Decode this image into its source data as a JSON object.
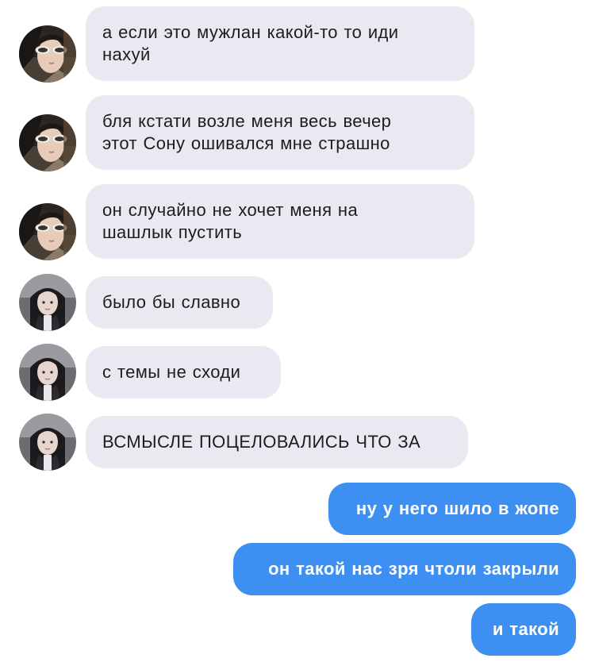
{
  "conversation": {
    "messages": [
      {
        "sender": "other-a",
        "avatar_icon": "avatar-sunglasses-icon",
        "lines": [
          "а если это мужлан какой-то то иди",
          "нахуй"
        ]
      },
      {
        "sender": "other-a",
        "avatar_icon": "avatar-sunglasses-icon",
        "lines": [
          "бля кстати возле меня весь вечер",
          "этот Сону ошивался мне страшно"
        ]
      },
      {
        "sender": "other-a",
        "avatar_icon": "avatar-sunglasses-icon",
        "lines": [
          "он случайно не хочет меня на",
          "шашлык пустить"
        ]
      },
      {
        "sender": "other-b",
        "avatar_icon": "avatar-girl-icon",
        "lines": [
          "было бы славно"
        ]
      },
      {
        "sender": "other-b",
        "avatar_icon": "avatar-girl-icon",
        "lines": [
          "с темы не сходи"
        ]
      },
      {
        "sender": "other-b",
        "avatar_icon": "avatar-girl-icon",
        "lines": [
          "ВСМЫСЛЕ ПОЦЕЛОВАЛИСЬ ЧТО ЗА"
        ]
      },
      {
        "sender": "me",
        "lines": [
          "ну у него шило в жопе"
        ]
      },
      {
        "sender": "me",
        "lines": [
          "он такой нас зря чтоли закрыли"
        ]
      },
      {
        "sender": "me",
        "lines": [
          "и такой"
        ]
      }
    ]
  },
  "colors": {
    "incoming_bubble": "#e9e9f2",
    "outgoing_bubble": "#3d90f1",
    "incoming_text": "#1d1d1f",
    "outgoing_text": "#ffffff"
  }
}
